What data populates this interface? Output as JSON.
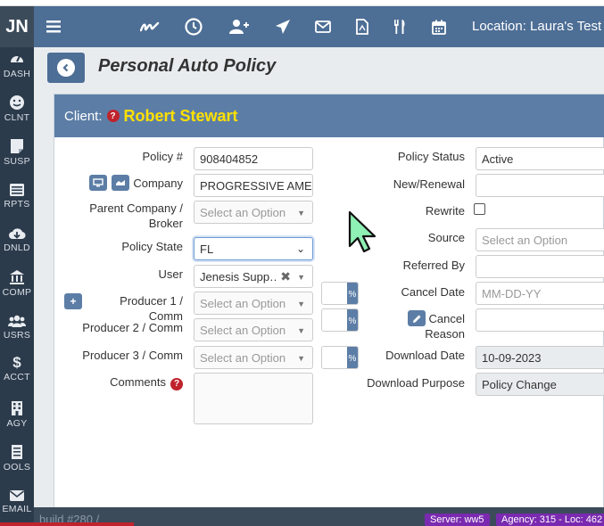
{
  "brand": {
    "text": "JN"
  },
  "topbar": {
    "icons": [
      "menu-icon",
      "signature-icon",
      "clock-icon",
      "add-user-icon",
      "send-icon",
      "mail-icon",
      "pdf-icon",
      "utensils-icon",
      "calendar-icon"
    ],
    "location_text": "Location: Laura's Test A"
  },
  "sidebar": {
    "items": [
      {
        "label": "DASH",
        "icon": "dashboard-icon"
      },
      {
        "label": "CLNT",
        "icon": "smile-icon"
      },
      {
        "label": "SUSP",
        "icon": "note-icon"
      },
      {
        "label": "RPTS",
        "icon": "reports-icon"
      },
      {
        "label": "DNLD",
        "icon": "cloud-download-icon"
      },
      {
        "label": "COMP",
        "icon": "bank-icon"
      },
      {
        "label": "USRS",
        "icon": "users-icon"
      },
      {
        "label": "ACCT",
        "icon": "dollar-icon"
      },
      {
        "label": "AGY",
        "icon": "building-icon"
      },
      {
        "label": "OOLS",
        "icon": "tools-icon"
      },
      {
        "label": "EMAIL",
        "icon": "envelope-icon"
      }
    ]
  },
  "page": {
    "title": "Personal Auto Policy"
  },
  "client": {
    "label": "Client:",
    "name": "Robert Stewart"
  },
  "form": {
    "policy_number": {
      "label": "Policy #",
      "value": "908404852"
    },
    "company": {
      "label": "Company",
      "value": "PROGRESSIVE AMERICAN"
    },
    "parent_company": {
      "label_line1": "Parent Company /",
      "label_line2": "Broker",
      "placeholder": "Select an Option"
    },
    "policy_state": {
      "label": "Policy State",
      "value": "FL"
    },
    "user": {
      "label": "User",
      "value": "Jenesis Supp…"
    },
    "producer1": {
      "label": "Producer 1 / Comm",
      "placeholder": "Select an Option",
      "pct": "%"
    },
    "producer2": {
      "label": "Producer 2 / Comm",
      "placeholder": "Select an Option",
      "pct": "%"
    },
    "producer3": {
      "label": "Producer 3 / Comm",
      "placeholder": "Select an Option",
      "pct": "%"
    },
    "comments": {
      "label": "Comments",
      "value": ""
    },
    "policy_status": {
      "label": "Policy Status",
      "value": "Active"
    },
    "new_renewal": {
      "label": "New/Renewal",
      "value": ""
    },
    "rewrite": {
      "label": "Rewrite",
      "checked": false
    },
    "source": {
      "label": "Source",
      "placeholder": "Select an Option"
    },
    "referred_by": {
      "label": "Referred By",
      "value": ""
    },
    "cancel_date": {
      "label": "Cancel Date",
      "placeholder": "MM-DD-YY"
    },
    "cancel_reason": {
      "label_line1": "Cancel",
      "label_line2": "Reason",
      "value": ""
    },
    "download_date": {
      "label": "Download Date",
      "value": "10-09-2023"
    },
    "download_purpose": {
      "label": "Download Purpose",
      "value": "Policy Change"
    }
  },
  "footer": {
    "build": "build #280 /",
    "server": "Server: ww5",
    "agency": "Agency: 315 - Loc: 462"
  },
  "colors": {
    "topbar": "#4d6e95",
    "sidebar": "#2c3b4b",
    "panel_header": "#5c7ea6",
    "client_name": "#ffe000",
    "badge": "#7a2ab0",
    "help": "#c0232c"
  }
}
